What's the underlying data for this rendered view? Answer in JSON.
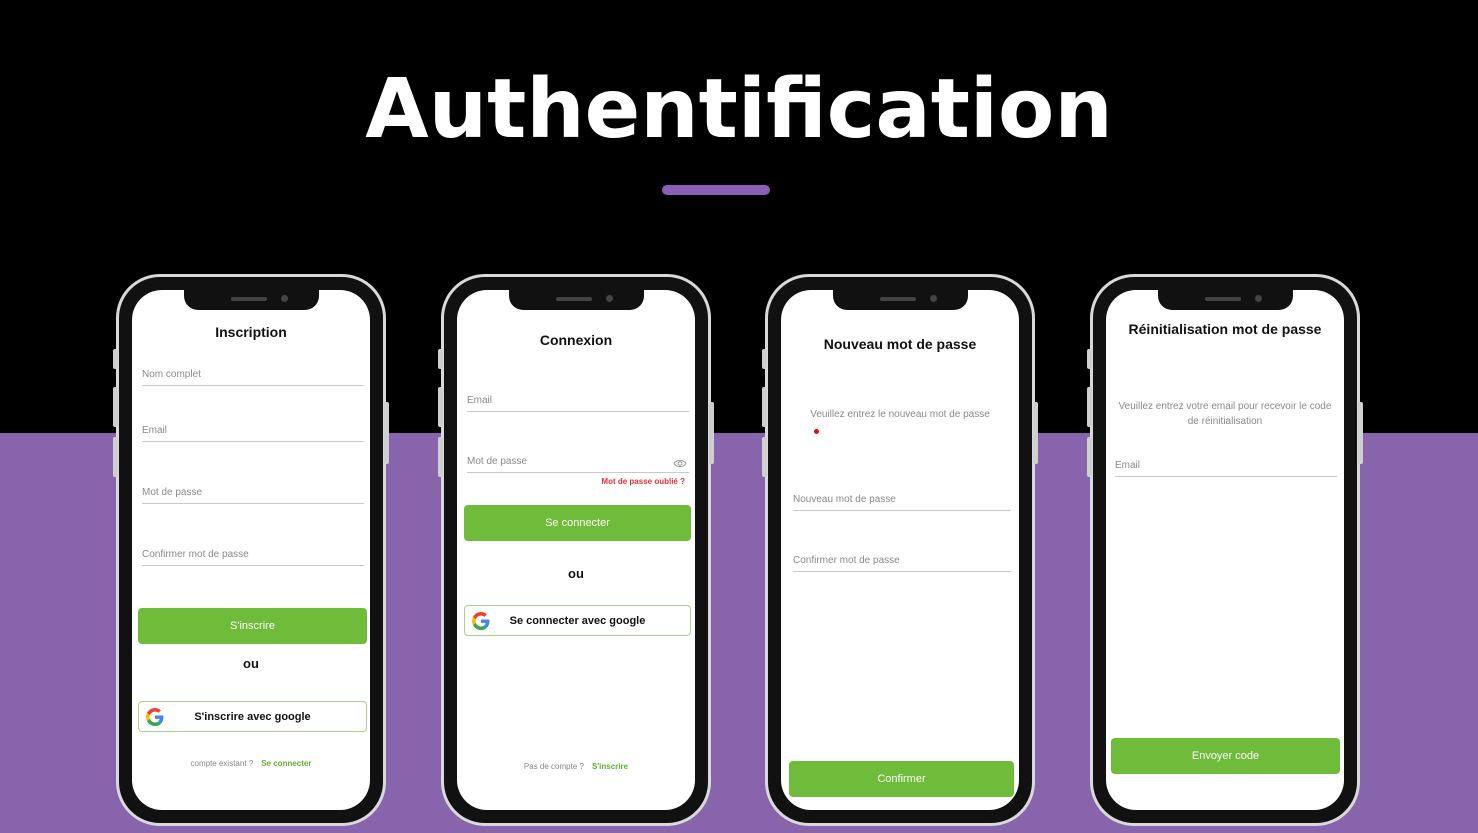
{
  "page": {
    "title": "Authentification"
  },
  "colors": {
    "accent": "#8764ab",
    "primary_button": "#6fbb3a",
    "link": "#5eb22c",
    "error": "#e53030"
  },
  "screens": {
    "inscription": {
      "title": "Inscription",
      "fields": [
        "Nom complet",
        "Email",
        "Mot de passe",
        "Confirmer mot de passe"
      ],
      "submit": "S'inscrire",
      "or": "ou",
      "google": "S'inscrire avec google",
      "footer_text": "compte existant ?",
      "footer_link": "Se connecter"
    },
    "connexion": {
      "title": "Connexion",
      "fields": [
        "Email",
        "Mot de passe"
      ],
      "forgot": "Mot de passe oublié ?",
      "submit": "Se connecter",
      "or": "ou",
      "google": "Se connecter avec google",
      "footer_text": "Pas de compte ?",
      "footer_link": "S'inscrire"
    },
    "nouveau": {
      "title": "Nouveau mot de passe",
      "hint": "Veuillez entrez le nouveau mot de passe",
      "fields": [
        "Nouveau mot de passe",
        "Confirmer mot de passe"
      ],
      "submit": "Confirmer"
    },
    "reinit": {
      "title": "Réinitialisation mot de passe",
      "hint": "Veuillez entrez votre email pour recevoir le code de réinitialisation",
      "fields": [
        "Email"
      ],
      "submit": "Envoyer code"
    }
  },
  "icons": {
    "google": "google-logo-icon",
    "eye": "eye-icon"
  }
}
